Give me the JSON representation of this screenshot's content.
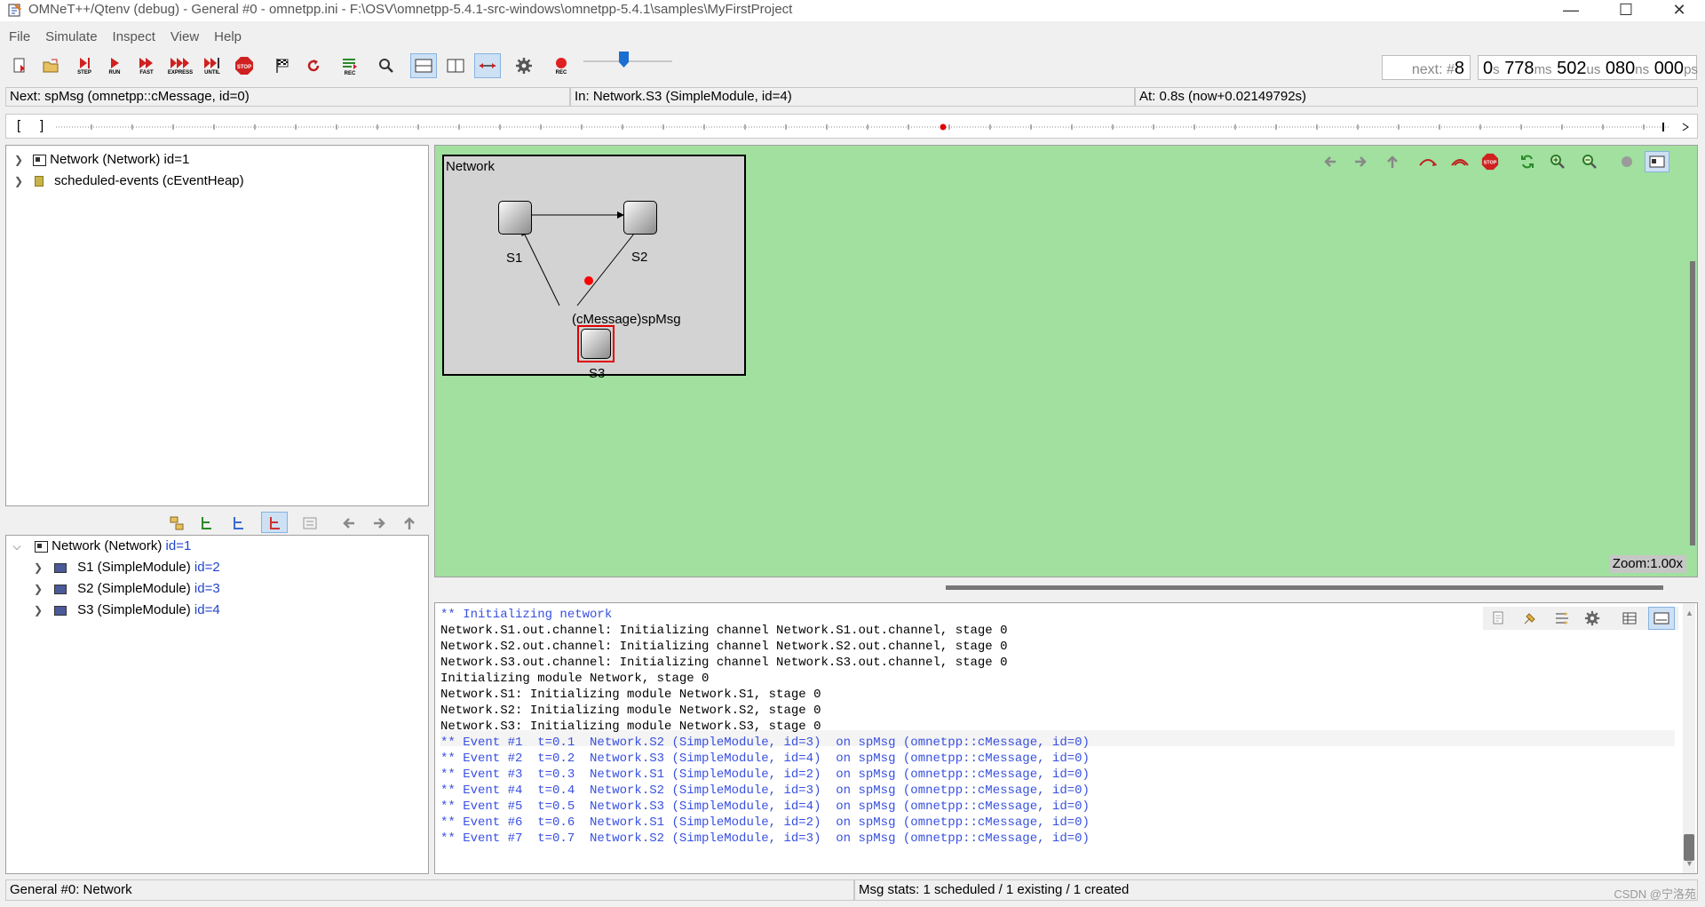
{
  "window": {
    "title": "OMNeT++/Qtenv (debug) - General #0 - omnetpp.ini - F:\\OSV\\omnetpp-5.4.1-src-windows\\omnetpp-5.4.1\\samples\\MyFirstProject",
    "minimize": "—",
    "maximize": "☐",
    "close": "✕"
  },
  "menu": [
    "File",
    "Simulate",
    "Inspect",
    "View",
    "Help"
  ],
  "toolbar": {
    "step_label": "STEP",
    "run_label": "RUN",
    "fast_label": "FAST",
    "express_label": "EXPRESS",
    "until_label": "UNTIL",
    "stop_label": "STOP",
    "rec_label": "REC",
    "speed_level": 0.45
  },
  "next_event": {
    "prefix": "next: #",
    "number": "8"
  },
  "sim_time": {
    "s": "0",
    "s_unit": "s",
    "ms": "778",
    "ms_unit": "ms",
    "us": "502",
    "us_unit": "us",
    "ns": "080",
    "ns_unit": "ns",
    "ps": "000",
    "ps_unit": "ps"
  },
  "info": {
    "next": "Next: spMsg (omnetpp::cMessage, id=0)",
    "in": "In: Network.S3 (SimpleModule, id=4)",
    "at": "At: 0.8s (now+0.02149792s)"
  },
  "timeline": {
    "open": "[",
    "close": "]",
    "event_position": 0.55
  },
  "object_tree": [
    {
      "label": "Network (Network) id=1",
      "icon": "network-icon"
    },
    {
      "label": "scheduled-events (cEventHeap)",
      "icon": "event-heap-icon"
    }
  ],
  "module_tree": {
    "root": {
      "label": "Network (Network) ",
      "id": "id=1"
    },
    "children": [
      {
        "label": "S1 (SimpleModule) ",
        "id": "id=2"
      },
      {
        "label": "S2 (SimpleModule) ",
        "id": "id=3"
      },
      {
        "label": "S3 (SimpleModule) ",
        "id": "id=4"
      }
    ]
  },
  "network_canvas": {
    "title": "Network",
    "nodes": [
      "S1",
      "S2",
      "S3"
    ],
    "message_label": "(cMessage)spMsg",
    "zoom": "Zoom:1.00x"
  },
  "log": {
    "lines": [
      {
        "text": "** Initializing network",
        "type": "event"
      },
      {
        "text": "Network.S1.out.channel: Initializing channel Network.S1.out.channel, stage 0",
        "type": "plain"
      },
      {
        "text": "Network.S2.out.channel: Initializing channel Network.S2.out.channel, stage 0",
        "type": "plain"
      },
      {
        "text": "Network.S3.out.channel: Initializing channel Network.S3.out.channel, stage 0",
        "type": "plain"
      },
      {
        "text": "Initializing module Network, stage 0",
        "type": "plain"
      },
      {
        "text": "Network.S1: Initializing module Network.S1, stage 0",
        "type": "plain"
      },
      {
        "text": "Network.S2: Initializing module Network.S2, stage 0",
        "type": "plain"
      },
      {
        "text": "Network.S3: Initializing module Network.S3, stage 0",
        "type": "plain"
      },
      {
        "text": "** Event #1  t=0.1  Network.S2 (SimpleModule, id=3)  on spMsg (omnetpp::cMessage, id=0)",
        "type": "event"
      },
      {
        "text": "** Event #2  t=0.2  Network.S3 (SimpleModule, id=4)  on spMsg (omnetpp::cMessage, id=0)",
        "type": "event"
      },
      {
        "text": "** Event #3  t=0.3  Network.S1 (SimpleModule, id=2)  on spMsg (omnetpp::cMessage, id=0)",
        "type": "event"
      },
      {
        "text": "** Event #4  t=0.4  Network.S2 (SimpleModule, id=3)  on spMsg (omnetpp::cMessage, id=0)",
        "type": "event"
      },
      {
        "text": "** Event #5  t=0.5  Network.S3 (SimpleModule, id=4)  on spMsg (omnetpp::cMessage, id=0)",
        "type": "event"
      },
      {
        "text": "** Event #6  t=0.6  Network.S1 (SimpleModule, id=2)  on spMsg (omnetpp::cMessage, id=0)",
        "type": "event"
      },
      {
        "text": "** Event #7  t=0.7  Network.S2 (SimpleModule, id=3)  on spMsg (omnetpp::cMessage, id=0)",
        "type": "event"
      }
    ]
  },
  "status": {
    "left": "General #0: Network",
    "right": "Msg stats: 1 scheduled / 1 existing / 1 created"
  },
  "watermark": "CSDN @宁洛苑"
}
